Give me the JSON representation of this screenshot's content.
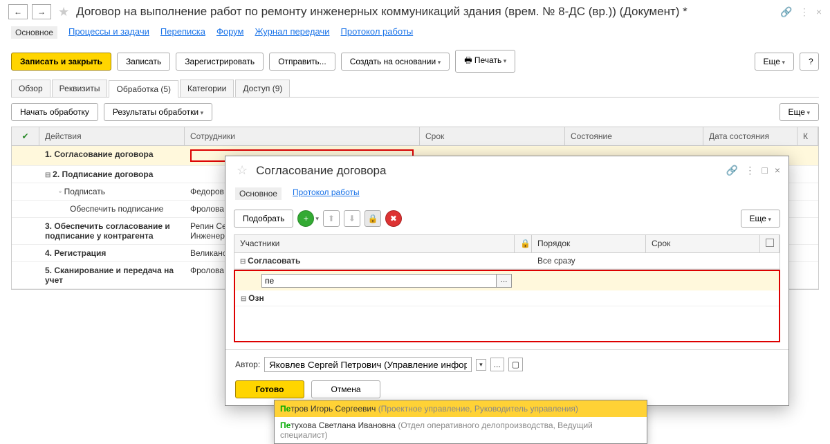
{
  "title": "Договор  на  выполнение работ по ремонту инженерных коммуникаций здания (врем. № 8-ДС (вр.)) (Документ) *",
  "nav": {
    "items": [
      "Основное",
      "Процессы и задачи",
      "Переписка",
      "Форум",
      "Журнал передачи",
      "Протокол работы"
    ],
    "active": 0
  },
  "toolbar": {
    "save_close": "Записать и закрыть",
    "save": "Записать",
    "register": "Зарегистрировать",
    "send": "Отправить...",
    "create_based": "Создать на основании",
    "print": "Печать",
    "more": "Еще",
    "help": "?"
  },
  "tabs": [
    "Обзор",
    "Реквизиты",
    "Обработка (5)",
    "Категории",
    "Доступ (9)"
  ],
  "tab_active": 2,
  "sub_toolbar": {
    "start": "Начать обработку",
    "results": "Результаты обработки",
    "more": "Еще"
  },
  "columns": {
    "c1": "",
    "c2": "Действия",
    "c3": "Сотрудники",
    "c4": "Срок",
    "c5": "Состояние",
    "c6": "Дата состояния",
    "c7": "К"
  },
  "rows": [
    {
      "num": "1.",
      "label": "Согласование договора",
      "emp": "",
      "hl": true
    },
    {
      "num": "2.",
      "label": "Подписание договора",
      "expand": true
    },
    {
      "label": "Подписать",
      "emp": "Федоров О",
      "indent": 2,
      "dot": true
    },
    {
      "label": "Обеспечить подписание",
      "emp": "Фролова",
      "indent": 2
    },
    {
      "num": "3.",
      "label": "Обеспечить согласование и подписание у контрагента",
      "emp": "Репин Серг\nИнженер-пр"
    },
    {
      "num": "4.",
      "label": "Регистрация",
      "emp": "Великанова"
    },
    {
      "num": "5.",
      "label": "Сканирование и передача на учет",
      "emp": "Фролова Е"
    }
  ],
  "dialog": {
    "title": "Согласование договора",
    "tabs": [
      "Основное",
      "Протокол работы"
    ],
    "tab_active": 0,
    "toolbar": {
      "pick": "Подобрать",
      "more": "Еще"
    },
    "columns": {
      "c1": "Участники",
      "c3": "Порядок",
      "c4": "Срок"
    },
    "group1": {
      "label": "Согласовать",
      "order": "Все сразу"
    },
    "input_value": "пе",
    "group2": "Озн",
    "suggestions": [
      {
        "prefix": "Пе",
        "name": "тров Игорь Сергеевич",
        "dept": "(Проектное управление, Руководитель управления)",
        "sel": true
      },
      {
        "prefix": "Пе",
        "name": "тухова Светлана Ивановна",
        "dept": "(Отдел оперативного делопроизводства, Ведущий специалист)",
        "sel": false
      }
    ],
    "author_label": "Автор:",
    "author_value": "Яковлев Сергей Петрович (Управление информационных",
    "done": "Готово",
    "cancel": "Отмена"
  }
}
